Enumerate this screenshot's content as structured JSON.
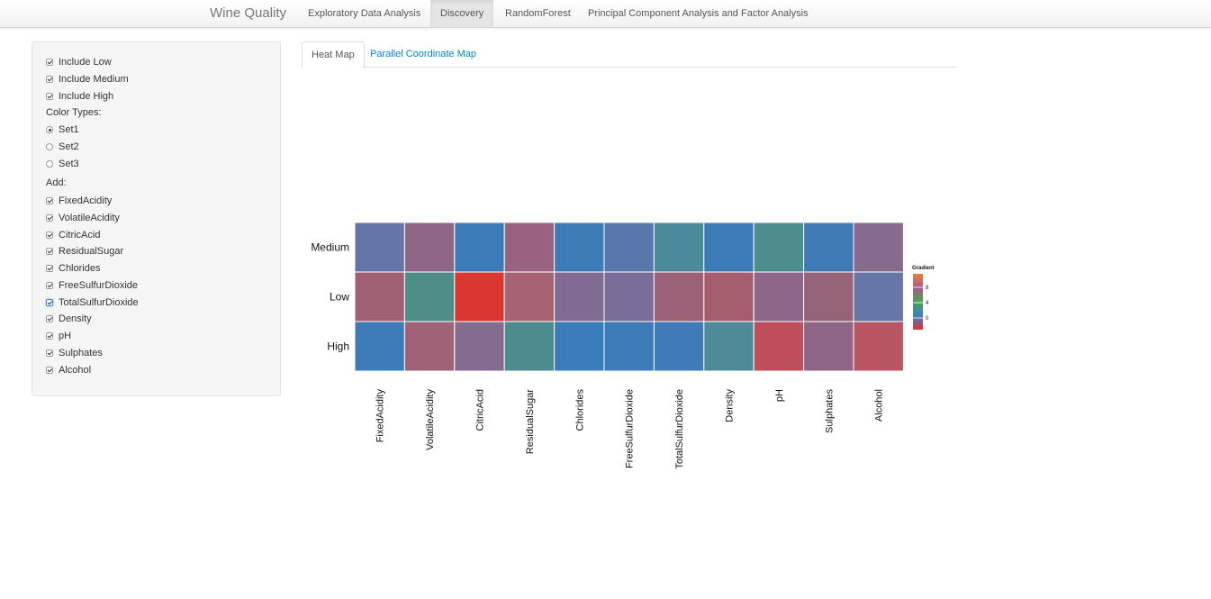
{
  "navbar": {
    "brand": "Wine Quality",
    "items": [
      {
        "label": "Exploratory Data Analysis",
        "active": false
      },
      {
        "label": "Discovery",
        "active": true
      },
      {
        "label": "RandomForest",
        "active": false
      },
      {
        "label": "Principal Component Analysis and Factor Analysis",
        "active": false
      }
    ]
  },
  "sidebar": {
    "include": [
      {
        "label": "Include Low",
        "checked": true
      },
      {
        "label": "Include Medium",
        "checked": true
      },
      {
        "label": "Include High",
        "checked": true
      }
    ],
    "color_types_label": "Color Types:",
    "color_types": [
      {
        "label": "Set1",
        "selected": true
      },
      {
        "label": "Set2",
        "selected": false
      },
      {
        "label": "Set3",
        "selected": false
      }
    ],
    "add_label": "Add:",
    "add": [
      {
        "label": "FixedAcidity",
        "checked": true
      },
      {
        "label": "VolatileAcidity",
        "checked": true
      },
      {
        "label": "CitricAcid",
        "checked": true
      },
      {
        "label": "ResidualSugar",
        "checked": true
      },
      {
        "label": "Chlorides",
        "checked": true
      },
      {
        "label": "FreeSulfurDioxide",
        "checked": true
      },
      {
        "label": "TotalSulfurDioxide",
        "checked": true,
        "focused": true
      },
      {
        "label": "Density",
        "checked": true
      },
      {
        "label": "pH",
        "checked": true
      },
      {
        "label": "Sulphates",
        "checked": true
      },
      {
        "label": "Alcohol",
        "checked": true
      }
    ]
  },
  "tabs": [
    {
      "label": "Heat Map",
      "active": true
    },
    {
      "label": "Parallel Coordinate Map",
      "active": false
    }
  ],
  "chart_data": {
    "type": "heatmap",
    "rows": [
      "Medium",
      "Low",
      "High"
    ],
    "columns": [
      "FixedAcidity",
      "VolatileAcidity",
      "CitricAcid",
      "ResidualSugar",
      "Chlorides",
      "FreeSulfurDioxide",
      "TotalSulfurDioxide",
      "Density",
      "pH",
      "Sulphates",
      "Alcohol"
    ],
    "cell_colors": [
      [
        "#6574a6",
        "#8f6585",
        "#3a7bb8",
        "#99637f",
        "#3d7bb7",
        "#5877ad",
        "#4b8a9a",
        "#3c7ab8",
        "#4d8d8d",
        "#3f7ab5",
        "#876b8f"
      ],
      [
        "#a06073",
        "#4f8e88",
        "#dc3631",
        "#a86373",
        "#816b93",
        "#7a6c99",
        "#9b6277",
        "#a65e6e",
        "#8c6789",
        "#976378",
        "#6676a6"
      ],
      [
        "#3d7bb8",
        "#9f6378",
        "#846c91",
        "#4c8b8e",
        "#3a7bba",
        "#3c7bb7",
        "#3e7bb8",
        "#4f8b97",
        "#bf4e5c",
        "#8f6585",
        "#b85560"
      ]
    ],
    "legend": {
      "title": "Gradient",
      "ticks": [
        "8",
        "4",
        "0"
      ],
      "gradient_colors": [
        "#e8803a",
        "#a85b8d",
        "#4ca34f",
        "#3d7ec0",
        "#e0342e"
      ]
    }
  }
}
